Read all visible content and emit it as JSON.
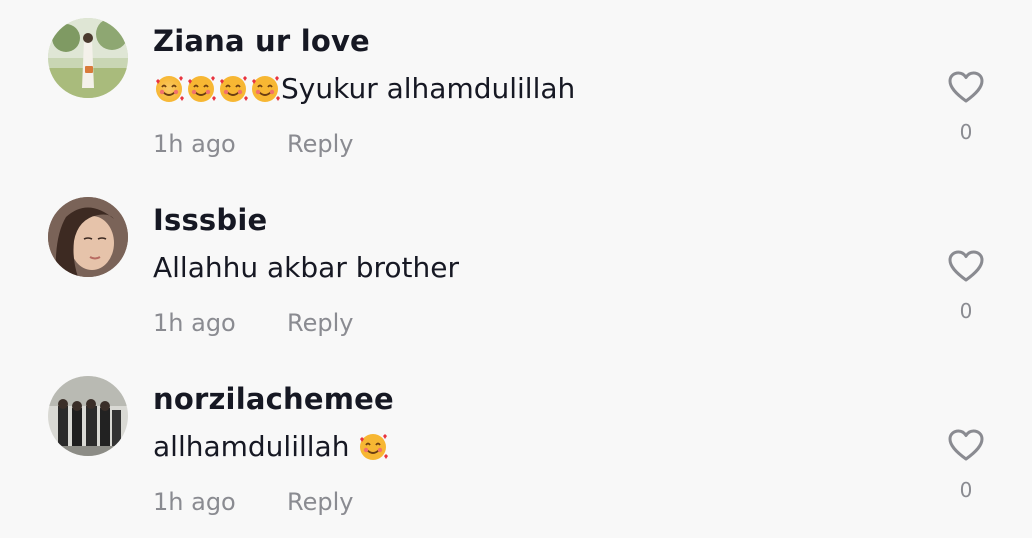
{
  "comments": [
    {
      "username": "Ziana ur love",
      "text": "Syukur alhamdulillah",
      "emoji_prefix_count": 4,
      "emoji_icon": "smiling-face-with-hearts-icon",
      "time": "1h ago",
      "reply_label": "Reply",
      "like_count": "0"
    },
    {
      "username": "Isssbie",
      "text": "Allahhu akbar brother",
      "time": "1h ago",
      "reply_label": "Reply",
      "like_count": "0"
    },
    {
      "username": "norzilachemee",
      "text": "allhamdulillah",
      "emoji_suffix_count": 1,
      "emoji_icon": "smiling-face-with-hearts-icon",
      "time": "1h ago",
      "reply_label": "Reply",
      "like_count": "0"
    }
  ],
  "icons": {
    "like": "heart-outline-icon"
  },
  "colors": {
    "background": "#f8f8f8",
    "text_primary": "#161823",
    "text_secondary": "#8a8b91"
  }
}
